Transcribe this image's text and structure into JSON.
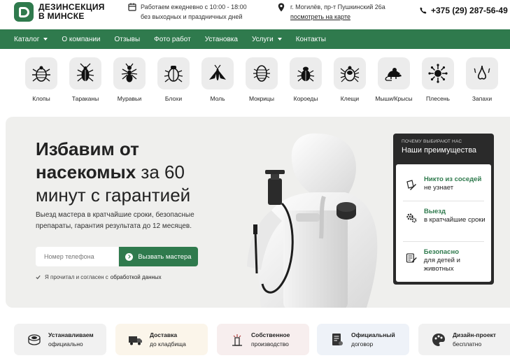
{
  "header": {
    "logo_text_line1": "ДЕЗИНСЕКЦИЯ",
    "logo_text_line2": "В МИНСКЕ",
    "hours_line1": "Работаем ежедневно с 10:00 - 18:00",
    "hours_line2": "без выходных и праздничных дней",
    "address": "г. Могилёв, пр-т Пушкинский 26а",
    "map_link": "посмотреть на карте",
    "phone": "+375 (29) 287-56-49"
  },
  "nav": {
    "items": [
      {
        "label": "Каталог",
        "dropdown": true
      },
      {
        "label": "О компании",
        "dropdown": false
      },
      {
        "label": "Отзывы",
        "dropdown": false
      },
      {
        "label": "Фото работ",
        "dropdown": false
      },
      {
        "label": "Установка",
        "dropdown": false
      },
      {
        "label": "Услуги",
        "dropdown": true
      },
      {
        "label": "Контакты",
        "dropdown": false
      }
    ]
  },
  "categories": [
    {
      "label": "Клопы",
      "icon": "bedbug-icon"
    },
    {
      "label": "Тараканы",
      "icon": "cockroach-icon"
    },
    {
      "label": "Муравьи",
      "icon": "ant-icon"
    },
    {
      "label": "Блохи",
      "icon": "flea-icon"
    },
    {
      "label": "Моль",
      "icon": "moth-icon"
    },
    {
      "label": "Мокрицы",
      "icon": "woodlouse-icon"
    },
    {
      "label": "Короеды",
      "icon": "bark-beetle-icon"
    },
    {
      "label": "Клещи",
      "icon": "tick-icon"
    },
    {
      "label": "Мыши/Крысы",
      "icon": "mouse-icon"
    },
    {
      "label": "Плесень",
      "icon": "mold-icon"
    },
    {
      "label": "Запахи",
      "icon": "smell-icon"
    }
  ],
  "hero": {
    "title_bold1": "Избавим от",
    "title_bold2": "насекомых",
    "title_rest1": " за 60",
    "title_line3": "минут с гарантией",
    "subtitle": "Выезд мастера в кратчайшие сроки, безопасные препараты, гарантия результата до 12 месяцев.",
    "phone_placeholder": "Номер телефона",
    "cta": "Вызвать мастера",
    "agree_text": "Я прочитал и согласен с",
    "agree_link": "обработкой данных"
  },
  "advantages": {
    "kicker": "ПОЧЕМУ ВЫБИРАЮТ НАС",
    "title": "Наши преимущества",
    "items": [
      {
        "highlight": "Никто из соседей",
        "rest": "не узнает",
        "icon": "pen-paper-icon"
      },
      {
        "highlight": "Выезд",
        "rest": "в кратчайшие сроки",
        "icon": "gears-icon"
      },
      {
        "highlight": "Безопасно",
        "rest": "для детей и животных",
        "icon": "document-pen-icon"
      }
    ]
  },
  "features": [
    {
      "line1": "Устанавливаем",
      "line2": "официально",
      "bg": "#f1f1f1",
      "icon": "stamp-icon"
    },
    {
      "line1": "Доставка",
      "line2": "до кладбища",
      "bg": "#fbf5ea",
      "icon": "truck-icon"
    },
    {
      "line1": "Собственное",
      "line2": "производство",
      "bg": "#f7eeee",
      "icon": "factory-icon"
    },
    {
      "line1": "Официальный",
      "line2": "договор",
      "bg": "#eef2f8",
      "icon": "contract-icon"
    },
    {
      "line1": "Дизайн-проект",
      "line2": "бесплатно",
      "bg": "#f1f1f1",
      "icon": "palette-icon"
    }
  ],
  "colors": {
    "brand_green": "#2f7a4d",
    "dark_card": "#2a2a2a",
    "hero_bg": "#efefed"
  }
}
